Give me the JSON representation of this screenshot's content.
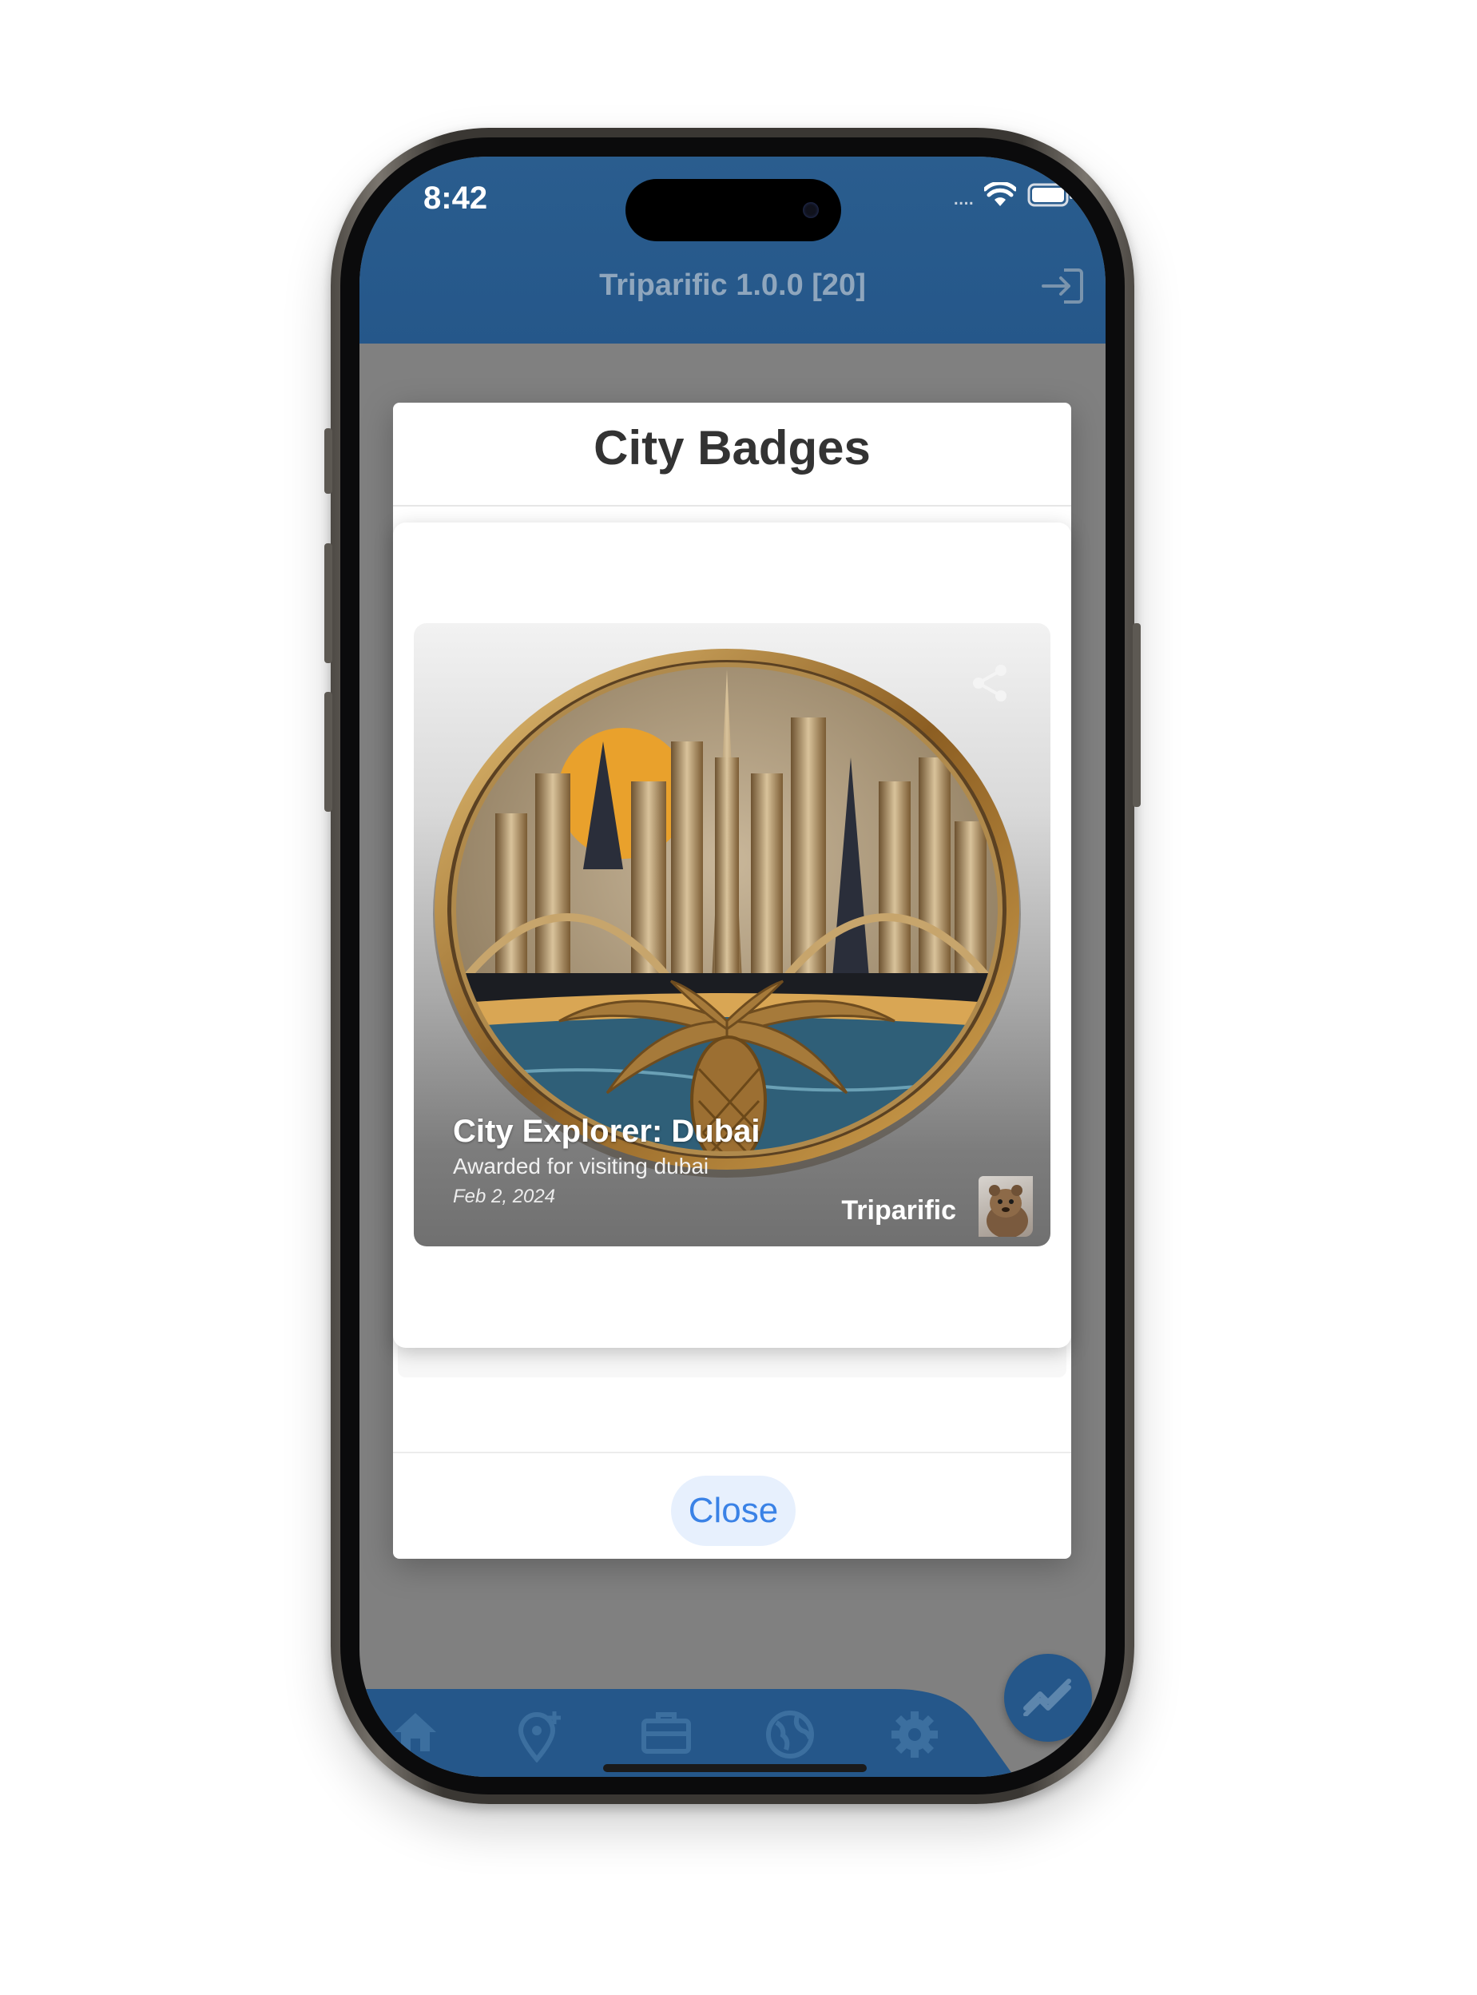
{
  "status_bar": {
    "time": "8:42",
    "signal": "....",
    "icons": [
      "wifi-icon",
      "battery-icon"
    ]
  },
  "app_bar": {
    "title": "Triparific 1.0.0 [20]",
    "logout_icon": "logout-icon"
  },
  "modal": {
    "title": "City Badges",
    "close_label": "Close"
  },
  "badge": {
    "name": "City Explorer: Dubai",
    "description": "Awarded for visiting dubai",
    "date": "Feb 2, 2024",
    "brand": "Triparific",
    "share_icon": "share-icon",
    "image": "dubai-skyline-badge"
  },
  "bottom_nav": {
    "items": [
      "home-icon",
      "add-location-icon",
      "briefcase-icon",
      "globe-icon",
      "gear-icon"
    ],
    "fab_icon": "trending-icon"
  },
  "colors": {
    "app_bar": "#25578a",
    "overlay": "#808080",
    "close_text": "#3a82e6",
    "close_bg": "#e7f0fd"
  }
}
